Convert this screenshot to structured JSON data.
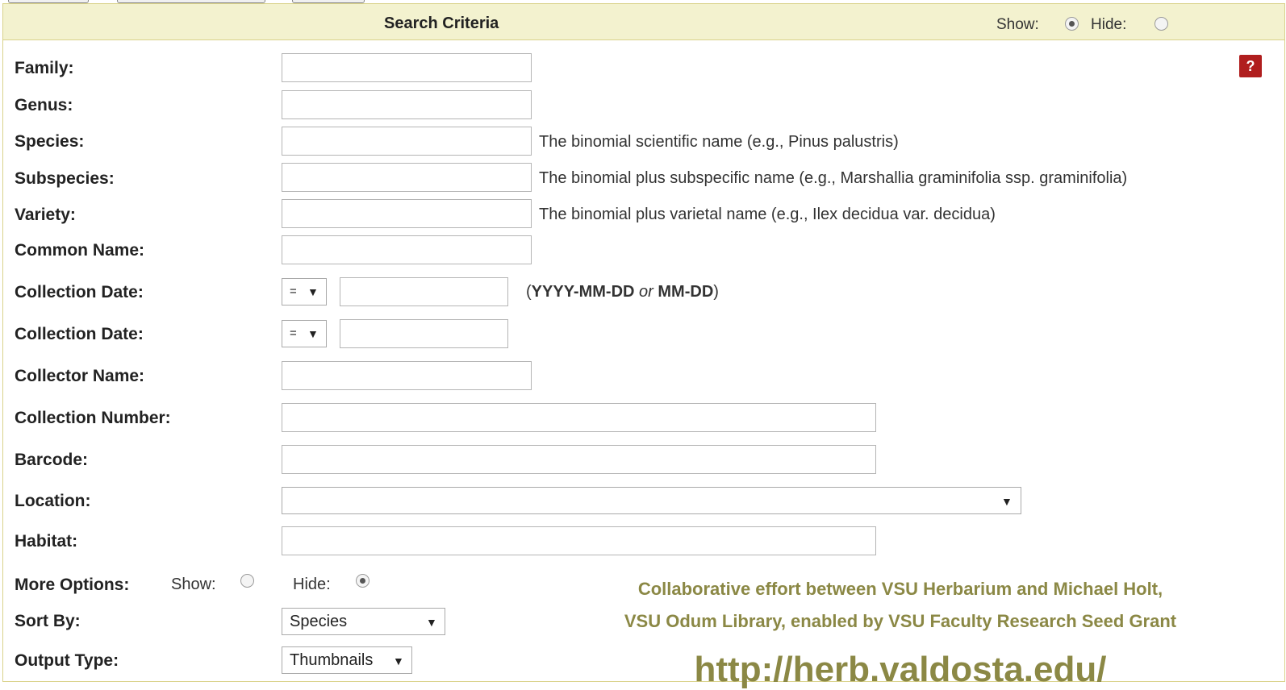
{
  "panel": {
    "title": "Search Criteria",
    "show_label": "Show:",
    "hide_label": "Hide:",
    "help_label": "?"
  },
  "fields": {
    "family": "Family:",
    "genus": "Genus:",
    "species": "Species:",
    "subspecies": "Subspecies:",
    "variety": "Variety:",
    "common_name": "Common Name:",
    "collection_date_1": "Collection Date:",
    "collection_date_2": "Collection Date:",
    "collector_name": "Collector Name:",
    "collection_number": "Collection Number:",
    "barcode": "Barcode:",
    "location": "Location:",
    "habitat": "Habitat:",
    "more_options": "More Options:",
    "sort_by": "Sort By:",
    "output_type": "Output Type:"
  },
  "hints": {
    "species": "The binomial scientific name (e.g., Pinus palustris)",
    "subspecies": "The binomial plus subspecific name (e.g., Marshallia graminifolia ssp. graminifolia)",
    "variety": "The binomial plus varietal name (e.g., Ilex decidua var. decidua)",
    "date_open": "(",
    "date_fmt_1": "YYYY-MM-DD",
    "date_or": "or",
    "date_fmt_2": "MM-DD",
    "date_close": ")"
  },
  "operators": {
    "date_1": "=",
    "date_2": "="
  },
  "more_options": {
    "show_label": "Show:",
    "hide_label": "Hide:"
  },
  "selects": {
    "sort_by": "Species",
    "output_type": "Thumbnails"
  },
  "credit": {
    "line1": "Collaborative effort between VSU Herbarium and Michael Holt,",
    "line2": "VSU Odum Library, enabled by VSU Faculty Research Seed Grant",
    "url": "http://herb.valdosta.edu/"
  },
  "icons": {
    "dropdown": "dropdown-arrow-icon",
    "radio_checked": "radio-checked",
    "radio_unchecked": "radio-unchecked"
  },
  "colors": {
    "header_bg": "#f3f2cf",
    "border": "#d9d28a",
    "credit_text": "#8b8845",
    "help_bg": "#b01e1e"
  }
}
